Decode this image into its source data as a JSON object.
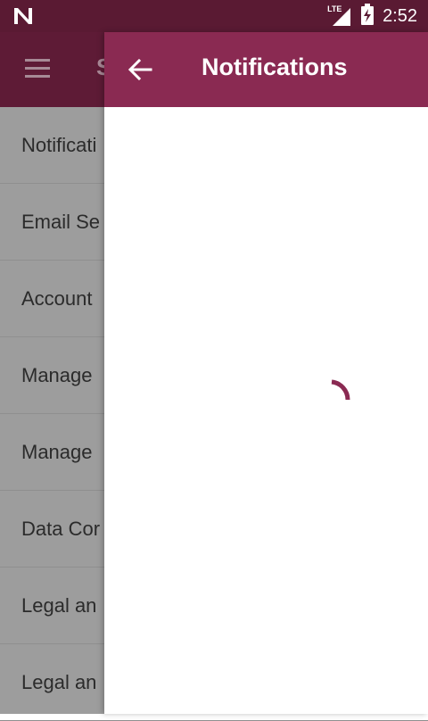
{
  "status_bar": {
    "time": "2:52",
    "network_label": "LTE",
    "icons": [
      "n-logo-icon",
      "signal-icon",
      "battery-charging-icon"
    ]
  },
  "under_page": {
    "title": "S",
    "menu_icon": "hamburger-menu-icon",
    "items": [
      {
        "label": "Notificati"
      },
      {
        "label": "Email Se"
      },
      {
        "label": "Account"
      },
      {
        "label": "Manage"
      },
      {
        "label": "Manage"
      },
      {
        "label": "Data Cor"
      },
      {
        "label": "Legal an"
      },
      {
        "label": "Legal an"
      }
    ]
  },
  "panel": {
    "title": "Notifications",
    "back_icon": "arrow-back-icon",
    "loading": true
  },
  "colors": {
    "status_bar_bg": "#5a1a33",
    "header_bg": "#8a2a52",
    "spinner": "#8a2a52",
    "scrim": "#9d9d9d"
  }
}
